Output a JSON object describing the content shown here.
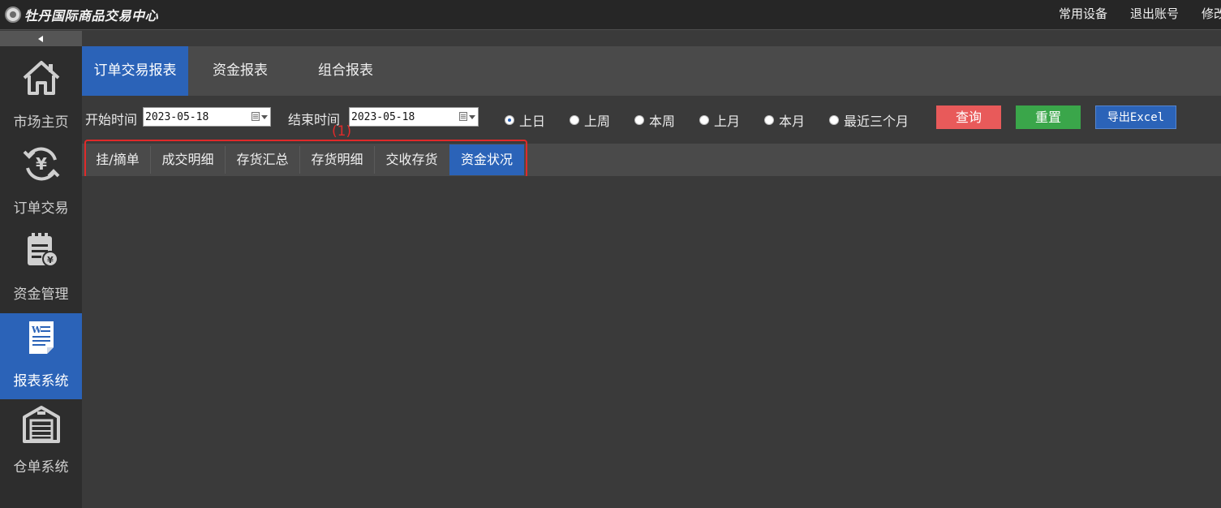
{
  "app": {
    "title": "牡丹国际商品交易中心"
  },
  "top_links": [
    {
      "label": "常用设备"
    },
    {
      "label": "退出账号"
    },
    {
      "label": "修改"
    }
  ],
  "sidebar": {
    "items": [
      {
        "label": "市场主页",
        "icon": "home-icon",
        "active": false
      },
      {
        "label": "订单交易",
        "icon": "yen-exchange-icon",
        "active": false
      },
      {
        "label": "资金管理",
        "icon": "fund-document-icon",
        "active": false
      },
      {
        "label": "报表系统",
        "icon": "report-document-icon",
        "active": true
      },
      {
        "label": "仓单系统",
        "icon": "warehouse-icon",
        "active": false
      }
    ]
  },
  "main_tabs": [
    {
      "label": "订单交易报表",
      "active": true
    },
    {
      "label": "资金报表",
      "active": false
    },
    {
      "label": "组合报表",
      "active": false
    }
  ],
  "filter": {
    "start_label": "开始时间",
    "start_value": "2023-05-18",
    "end_label": "结束时间",
    "end_value": "2023-05-18",
    "periods": [
      {
        "label": "上日",
        "checked": true
      },
      {
        "label": "上周",
        "checked": false
      },
      {
        "label": "本周",
        "checked": false
      },
      {
        "label": "上月",
        "checked": false
      },
      {
        "label": "本月",
        "checked": false
      },
      {
        "label": "最近三个月",
        "checked": false
      }
    ],
    "query_label": "查询",
    "reset_label": "重置",
    "export_label": "导出Excel"
  },
  "annotation": {
    "label": "(1)",
    "color": "#e02a2a"
  },
  "sub_tabs": [
    {
      "label": "挂/摘单",
      "active": false
    },
    {
      "label": "成交明细",
      "active": false
    },
    {
      "label": "存货汇总",
      "active": false
    },
    {
      "label": "存货明细",
      "active": false
    },
    {
      "label": "交收存货",
      "active": false
    },
    {
      "label": "资金状况",
      "active": true
    }
  ],
  "colors": {
    "accent": "#2b63b8",
    "query": "#e85a5a",
    "reset": "#3aa64a",
    "background": "#3a3a3a"
  }
}
